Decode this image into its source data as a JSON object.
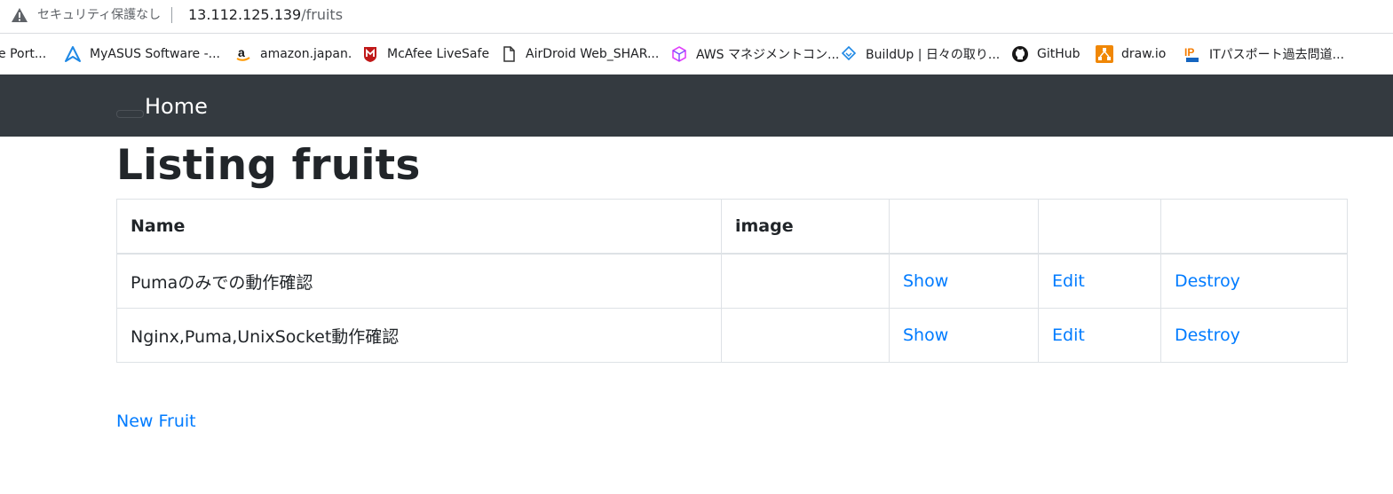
{
  "browser": {
    "security_label": "セキュリティ保護なし",
    "url_host": "13.112.125.139",
    "url_path": "/fruits",
    "bookmarks": [
      {
        "label": "e Port...",
        "icon": "none"
      },
      {
        "label": "MyASUS Software -...",
        "icon": "myasus-icon"
      },
      {
        "label": "amazon.japan.",
        "icon": "amazon-icon"
      },
      {
        "label": "McAfee LiveSafe",
        "icon": "mcafee-icon"
      },
      {
        "label": "AirDroid Web_SHAR...",
        "icon": "page-icon"
      },
      {
        "label": "AWS マネジメントコン...",
        "icon": "aws-icon"
      },
      {
        "label": "BuildUp | 日々の取り...",
        "icon": "buildup-icon"
      },
      {
        "label": "GitHub",
        "icon": "github-icon"
      },
      {
        "label": "draw.io",
        "icon": "drawio-icon"
      },
      {
        "label": "ITパスポート過去問道...",
        "icon": "ip-com-icon"
      }
    ]
  },
  "navbar": {
    "brand": "Home"
  },
  "main": {
    "title": "Listing fruits",
    "table": {
      "headers": [
        "Name",
        "image",
        "",
        "",
        ""
      ],
      "rows": [
        {
          "name": "Pumaのみでの動作確認",
          "image": "",
          "show": "Show",
          "edit": "Edit",
          "destroy": "Destroy"
        },
        {
          "name": "Nginx,Puma,UnixSocket動作確認",
          "image": "",
          "show": "Show",
          "edit": "Edit",
          "destroy": "Destroy"
        }
      ]
    },
    "new_link": "New Fruit"
  },
  "colors": {
    "navbar_bg": "#343a40",
    "link": "#007bff",
    "text": "#212529",
    "border": "#dee2e6"
  }
}
